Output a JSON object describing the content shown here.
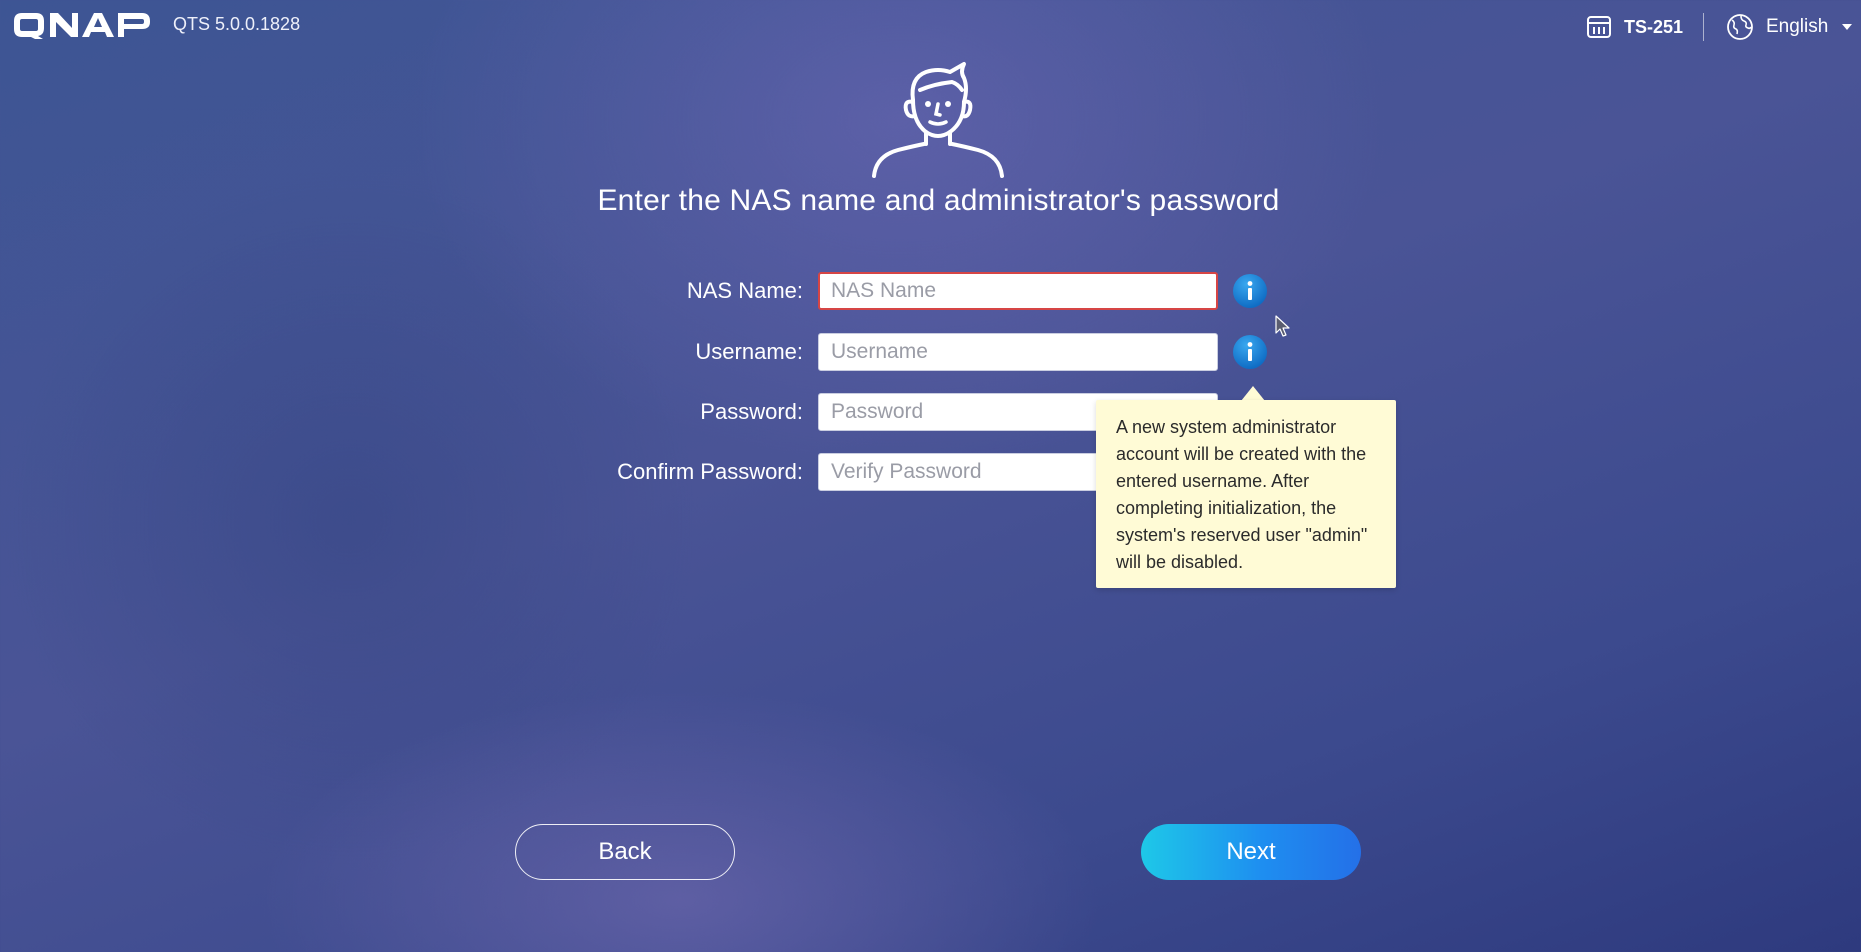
{
  "header": {
    "logo_text": "QNAP",
    "version": "QTS 5.0.0.1828",
    "model": "TS-251",
    "language": "English"
  },
  "icons": {
    "logo": "qnap-logo",
    "model": "nas-device-icon",
    "language": "globe-icon",
    "language_dropdown": "caret-down-icon",
    "hero": "admin-avatar-icon",
    "info": "info-icon"
  },
  "page": {
    "title": "Enter the NAS name and administrator's password"
  },
  "form": {
    "nas_name": {
      "label": "NAS Name:",
      "placeholder": "NAS Name",
      "value": "",
      "state": "error"
    },
    "username": {
      "label": "Username:",
      "placeholder": "Username",
      "value": ""
    },
    "password": {
      "label": "Password:",
      "placeholder": "Password",
      "value": ""
    },
    "confirm_password": {
      "label": "Confirm Password:",
      "placeholder": "Verify Password",
      "value": ""
    }
  },
  "tooltip": {
    "text": "A new system administrator account will be created with the entered username. After completing initialization, the system's reserved user \"admin\" will be disabled."
  },
  "buttons": {
    "back": "Back",
    "next": "Next"
  },
  "colors": {
    "background_top": "#3d5594",
    "background_bottom": "#2e3a7e",
    "tooltip_bg": "#fffbd6",
    "info_blue": "#1a7fd4",
    "next_gradient_start": "#1ec8e8",
    "next_gradient_end": "#2470e8",
    "error_border": "#d64545"
  }
}
